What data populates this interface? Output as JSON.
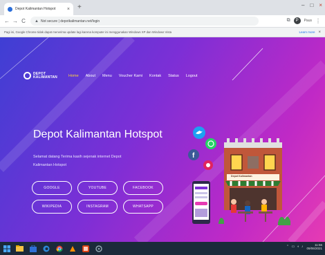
{
  "browser": {
    "tab_title": "Depot Kalimantan Hotspot",
    "tab_close": "×",
    "new_tab": "+",
    "window_controls": [
      "–",
      "□",
      "×"
    ],
    "nav_back": "←",
    "nav_forward": "→",
    "nav_reload": "C",
    "address_prefix": "Not secure",
    "address": "depotkalimantan.net/login",
    "profile_initial": "P",
    "profile_label": "Paus",
    "menu": "⋮",
    "info_text": "Pagi ini, Google Chrome tidak dapat menerima update lagi karena komputer ini menggunakan Windows XP dan Windows Vista",
    "info_link": "Learn more",
    "info_close": "×",
    "icons": {
      "lock": "info-icon",
      "translate": "translate-icon",
      "menu": "kebab-menu-icon"
    }
  },
  "site": {
    "logo_line1": "DEPOT",
    "logo_line2": "KALIMANTAN",
    "nav": [
      "Home",
      "About",
      "Menu",
      "Voucher Kami",
      "Kontak",
      "Status",
      "Logout"
    ],
    "active_nav": "Home",
    "hero_title": "Depot Kalimantan Hotspot",
    "hero_line1": "Selamat datang Terima kasih sejenak internet Depot",
    "hero_line2": "Kalimantan Hotspot",
    "buttons": [
      "GOOGLE",
      "YOUTUBE",
      "FACEBOOK",
      "WIKIPEDIA",
      "INSTAGRAM",
      "WHATSAPP"
    ],
    "shop_sign": "Depot Kalimantan",
    "colors": {
      "gradient_start": "#3e3fd4",
      "gradient_mid": "#7c2fd6",
      "gradient_end": "#e63bb3",
      "active_nav": "#ffd43b",
      "text": "#ffffff"
    }
  },
  "taskbar": {
    "time": "11:56",
    "date": "09/06/2021",
    "icons": [
      "windows-start-icon",
      "file-explorer-icon",
      "store-icon",
      "edge-icon",
      "chrome-icon",
      "paint-icon",
      "photos-icon",
      "settings-icon"
    ]
  }
}
